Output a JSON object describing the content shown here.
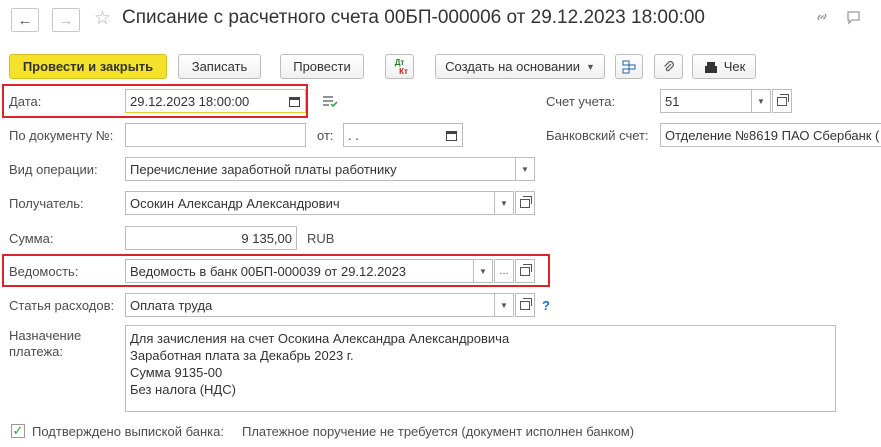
{
  "window": {
    "title": "Списание с расчетного счета 00БП-000006 от 29.12.2023 18:00:00",
    "back_icon": "back-arrow-icon",
    "forward_icon": "forward-arrow-icon",
    "favorite_icon": "star-icon",
    "link_icon": "link-icon",
    "chat_icon": "chat-icon"
  },
  "toolbar": {
    "post_close": "Провести и закрыть",
    "save": "Записать",
    "post": "Провести",
    "dt_kt_top": "Дт",
    "dt_kt_bottom": "Кт",
    "create_based": "Создать на основании",
    "receipt": "Чек"
  },
  "form": {
    "date_label": "Дата:",
    "date_value": "29.12.2023 18:00:00",
    "account_label": "Счет учета:",
    "account_value": "51",
    "doc_no_label": "По документу №:",
    "doc_no_value": "",
    "from_label": "от:",
    "from_value": " .  .",
    "bank_account_label": "Банковский счет:",
    "bank_account_value": "Отделение №8619 ПАО Сбербанк (",
    "operation_label": "Вид операции:",
    "operation_value": "Перечисление заработной платы работнику",
    "recipient_label": "Получатель:",
    "recipient_value": "Осокин Александр Александрович",
    "amount_label": "Сумма:",
    "amount_value": "9 135,00",
    "currency": "RUB",
    "statement_label": "Ведомость:",
    "statement_value": "Ведомость в банк 00БП-000039 от 29.12.2023",
    "expense_label": "Статья расходов:",
    "expense_value": "Оплата труда",
    "help_mark": "?",
    "purpose_label_1": "Назначение",
    "purpose_label_2": "платежа:",
    "purpose_value": "Для зачисления на счет Осокина Александра Александровича\nЗаработная плата за Декабрь 2023 г.\nСумма 9135-00\nБез налога (НДС)",
    "confirmed_label": "Подтверждено выпиской банка:",
    "confirmed_checked": true,
    "order_note": "Платежное поручение не требуется (документ исполнен банком)"
  },
  "colors": {
    "primary_button": "#f5e22a",
    "highlight": "#d9242b",
    "check": "#2a9d3a"
  }
}
